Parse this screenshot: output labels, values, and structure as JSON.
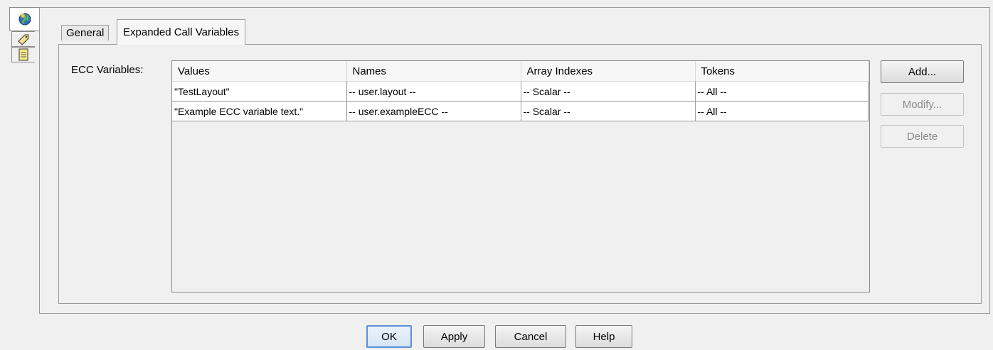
{
  "side_tabs": [
    {
      "icon": "globe-icon"
    },
    {
      "icon": "tag-icon"
    },
    {
      "icon": "notepad-icon"
    }
  ],
  "tabs": [
    {
      "label": "General"
    },
    {
      "label": "Expanded Call Variables"
    }
  ],
  "ecc_label": "ECC Variables:",
  "table": {
    "columns": [
      "Values",
      "Names",
      "Array Indexes",
      "Tokens"
    ],
    "rows": [
      [
        "\"TestLayout\"",
        "-- user.layout --",
        "-- Scalar --",
        "-- All --"
      ],
      [
        "\"Example ECC variable text.\"",
        "-- user.exampleECC --",
        "-- Scalar --",
        "-- All --"
      ]
    ]
  },
  "side_buttons": {
    "add": "Add...",
    "modify": "Modify...",
    "delete": "Delete"
  },
  "bottom_buttons": {
    "ok": "OK",
    "apply": "Apply",
    "cancel": "Cancel",
    "help": "Help"
  }
}
